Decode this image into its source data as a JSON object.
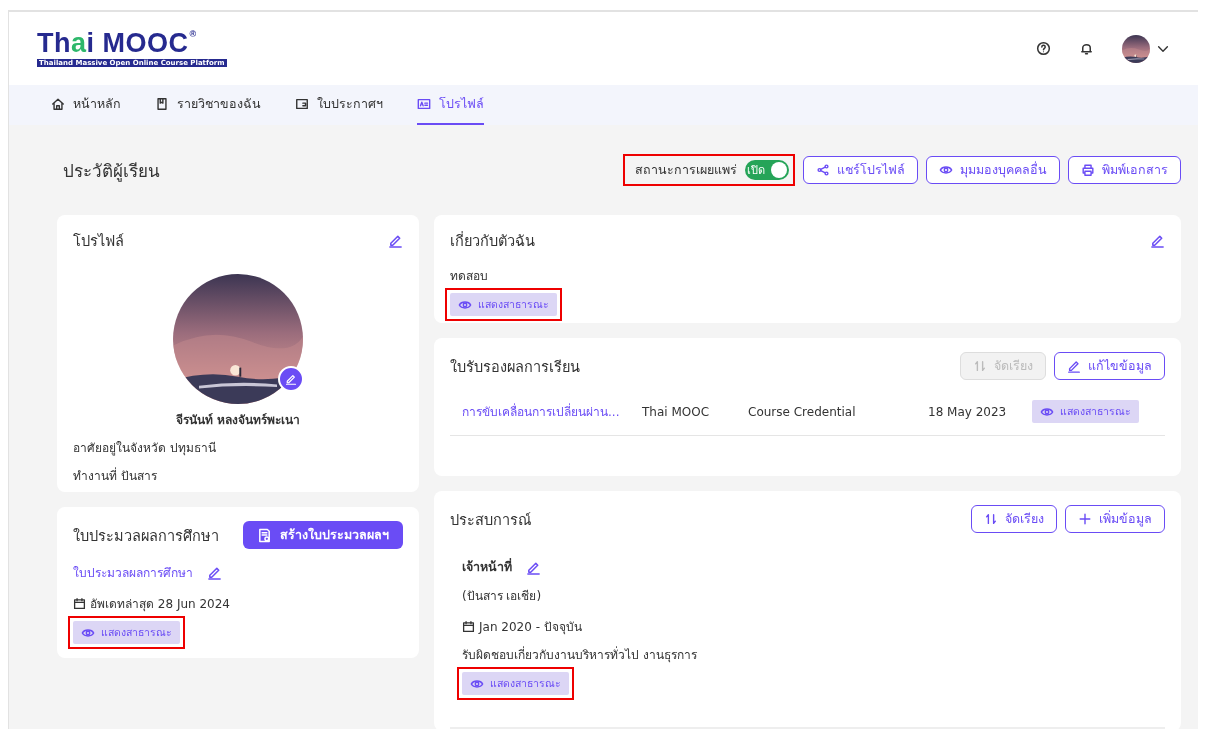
{
  "header": {
    "logo": {
      "name": "Th",
      "accent": "a",
      "rest": "i MOOC",
      "mark": "®",
      "tagline": "Thailand Massive Open Online Course Platform"
    }
  },
  "nav": {
    "tabs": [
      {
        "label": "หน้าหลัก",
        "kind": "home",
        "selected": false
      },
      {
        "label": "รายวิชาของฉัน",
        "kind": "book",
        "selected": false
      },
      {
        "label": "ใบประกาศฯ",
        "kind": "certificate",
        "selected": false
      },
      {
        "label": "โปรไฟล์",
        "kind": "idcard",
        "selected": true
      }
    ]
  },
  "page_title": "ประวัติผู้เรียน",
  "publish": {
    "label": "สถานะการเผยแพร่",
    "on": true,
    "text": "เปิด",
    "highlighted": true
  },
  "actions": [
    {
      "label": "แชร์โปรไฟล์",
      "kind": "share"
    },
    {
      "label": "มุมมองบุคคลอื่น",
      "kind": "eye"
    },
    {
      "label": "พิมพ์เอกสาร",
      "kind": "print"
    }
  ],
  "profile": {
    "title": "โปรไฟล์",
    "name": "จีรนันท์ หลงจันทร์พะเนา",
    "lines": [
      "อาศัยอยู่ในจังหวัด ปทุมธานี",
      "ทำงานที่ ปันสาร"
    ]
  },
  "portfolio": {
    "title": "ใบประมวลผลการศึกษา",
    "button": "สร้างใบประมวลผลฯ",
    "link": "ใบประมวลผลการศึกษา",
    "updated": "อัพเดทล่าสุด 28 Jun 2024",
    "visibility": "แสดงสาธารณะ",
    "highlighted": true
  },
  "about": {
    "title": "เกี่ยวกับตัวฉัน",
    "text": "ทดสอบ",
    "visibility": "แสดงสาธารณะ",
    "highlighted": true
  },
  "credentials": {
    "title": "ใบรับรองผลการเรียน",
    "buttons": [
      {
        "label": "จัดเรียง",
        "kind": "sort",
        "disabled": true
      },
      {
        "label": "แก้ไขข้อมูล",
        "kind": "pencil",
        "disabled": false
      }
    ],
    "rows": [
      {
        "title": "การขับเคลื่อนการเปลี่ยนผ่าน...",
        "issuer": "Thai MOOC",
        "type": "Course Credential",
        "date": "18 May 2023",
        "visibility": "แสดงสาธารณะ",
        "highlighted": false
      }
    ]
  },
  "experience": {
    "title": "ประสบการณ์",
    "buttons": [
      {
        "label": "จัดเรียง",
        "kind": "sort",
        "disabled": false
      },
      {
        "label": "เพิ่มข้อมูล",
        "kind": "plus",
        "disabled": false
      }
    ],
    "items": [
      {
        "position": "เจ้าหน้าที่",
        "company": "(ปันสาร เอเชีย)",
        "period": "Jan 2020 - ปัจจุบัน",
        "description": "รับผิดชอบเกี่ยวกับงานบริหารทั่วไป งานธุรการ",
        "visibility": "แสดงสาธารณะ",
        "highlighted": true
      }
    ]
  }
}
